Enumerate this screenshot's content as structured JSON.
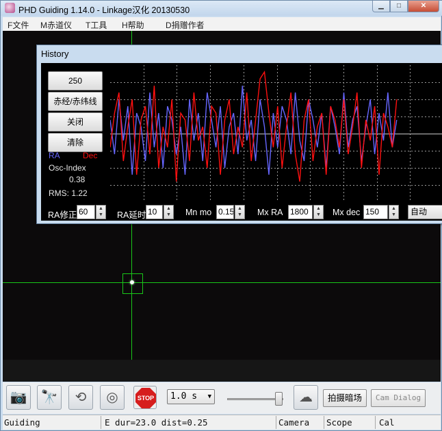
{
  "window": {
    "title": "PHD Guiding 1.14.0  -  Linkage汉化 20130530",
    "min_label": "▁",
    "max_label": "□",
    "close_label": "✕"
  },
  "menu": [
    "F文件",
    "M赤道仪",
    "T工具",
    "H帮助",
    "D捐赠作者"
  ],
  "history": {
    "title": "History",
    "buttons": [
      "250",
      "赤经/赤纬线",
      "关闭",
      "清除"
    ],
    "legend_ra": "RA",
    "legend_dec": "Dec",
    "osc_label": "Osc-Index",
    "osc_value": "0.38",
    "rms": "RMS: 1.22",
    "controls": {
      "ra_aggr_label": "RA修正",
      "ra_aggr_value": "60",
      "ra_hyst_label": "RA延时",
      "ra_hyst_value": "10",
      "mn_mo_label": "Mn mo",
      "mn_mo_value": "0.15",
      "mx_ra_label": "Mx RA",
      "mx_ra_value": "1800",
      "mx_dec_label": "Mx dec",
      "mx_dec_value": "150",
      "dec_mode_value": "自动"
    }
  },
  "toolbar": {
    "exposure_value": "1.0 s",
    "darks_label": "拍摄暗场",
    "cam_dialog_label": "Cam Dialog",
    "stop_label": "STOP",
    "exposure_gain_level": 0.9
  },
  "status": {
    "state": "Guiding",
    "info": "E dur=23.0 dist=0.25",
    "camera": "Camera",
    "scope": "Scope",
    "cal": "Cal"
  },
  "colors": {
    "ra": "#6666ff",
    "dec": "#ff1010",
    "crosshair": "#19c819"
  },
  "icons": [
    "camera-icon",
    "telescope-icon",
    "loop-icon",
    "guide-target-icon",
    "stop-icon",
    "brain-icon"
  ],
  "chart_data": {
    "type": "line",
    "series": [
      {
        "name": "RA",
        "values": [
          0.2,
          -0.3,
          0.5,
          -0.1,
          0.4,
          -0.6,
          0.3,
          0.1,
          -0.4,
          0.6,
          -0.2,
          0.3,
          -0.5,
          0.4,
          0.2,
          -0.3,
          0.1,
          -0.6,
          0.5,
          -0.1,
          0.3,
          -0.4,
          0.6,
          0.2,
          -0.2,
          0.4,
          -0.5,
          0.1,
          0.3,
          -0.3,
          0.7,
          -0.1,
          0.2,
          -0.4,
          0.5,
          0.1,
          -0.6,
          0.3,
          -0.2,
          0.4,
          0.2,
          -0.3,
          0.6,
          -0.1,
          -0.4,
          0.5,
          0.2,
          -0.2,
          0.3,
          -0.5,
          0.4,
          0.1,
          -0.3,
          0.6,
          -0.2,
          0.2,
          0.4,
          -0.4,
          0.1,
          0.5,
          -0.3,
          0.3,
          -0.1,
          0.6,
          -0.2,
          0.2
        ]
      },
      {
        "name": "Dec",
        "values": [
          -0.2,
          0.3,
          0.6,
          -0.4,
          0.1,
          0.5,
          -0.6,
          0.2,
          0.4,
          -0.3,
          0.7,
          -0.5,
          0.1,
          -0.2,
          0.5,
          -0.7,
          0.3,
          0.2,
          -0.4,
          0.6,
          -0.1,
          0.1,
          -0.5,
          0.4,
          0.3,
          -0.6,
          0.2,
          0.5,
          -0.3,
          0.1,
          -0.2,
          0.6,
          -0.4,
          0.2,
          0.8,
          0.9,
          0.3,
          -0.2,
          0.4,
          -0.5,
          0.1,
          0.6,
          -0.3,
          -0.7,
          0.2,
          0.5,
          -0.4,
          0.1,
          0.3,
          -0.6,
          0.4,
          0.2,
          -0.2,
          0.5,
          -0.3,
          0.1,
          0.6,
          -0.5,
          0.2,
          -0.1,
          0.4,
          -0.6,
          0.3,
          0.1,
          -0.2,
          0.5
        ]
      }
    ],
    "ylim": [
      -1,
      1
    ],
    "grid": true
  }
}
